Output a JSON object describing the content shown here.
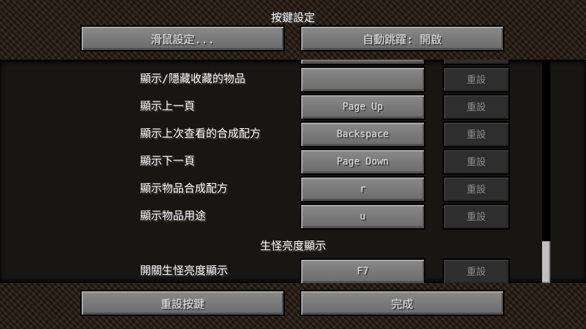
{
  "title": "按鍵設定",
  "top_buttons": {
    "mouse_settings": "滑鼠設定...",
    "auto_jump": "自動跳躍: 開啟"
  },
  "keybinds": [
    {
      "label": "顯示/隱藏收藏的物品",
      "key": "",
      "reset": "重設"
    },
    {
      "label": "顯示上一頁",
      "key": "Page Up",
      "reset": "重設"
    },
    {
      "label": "顯示上次查看的合成配方",
      "key": "Backspace",
      "reset": "重設"
    },
    {
      "label": "顯示下一頁",
      "key": "Page Down",
      "reset": "重設"
    },
    {
      "label": "顯示物品合成配方",
      "key": "r",
      "reset": "重設"
    },
    {
      "label": "顯示物品用途",
      "key": "u",
      "reset": "重設"
    }
  ],
  "section": {
    "title": "生怪亮度顯示",
    "items": [
      {
        "label": "開關生怪亮度顯示",
        "key": "F7",
        "reset": "重設"
      }
    ]
  },
  "bottom_buttons": {
    "reset_keys": "重設按鍵",
    "done": "完成"
  }
}
